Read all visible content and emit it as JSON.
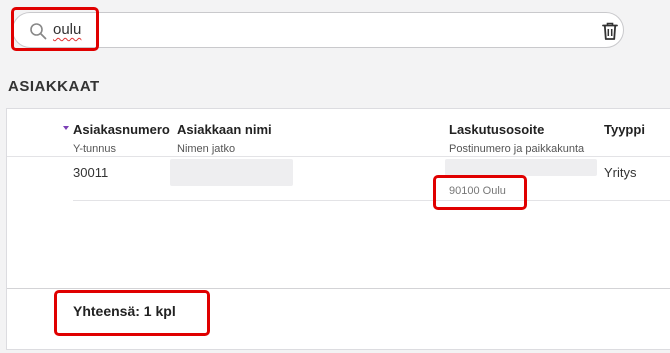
{
  "search": {
    "value": "oulu"
  },
  "section_title": "ASIAKKAAT",
  "table": {
    "columns": [
      {
        "title": "Asiakasnumero",
        "subtitle": "Y-tunnus"
      },
      {
        "title": "Asiakkaan nimi",
        "subtitle": "Nimen jatko"
      },
      {
        "title": "Laskutusosoite",
        "subtitle": "Postinumero ja paikkakunta"
      },
      {
        "title": "Tyyppi",
        "subtitle": ""
      }
    ],
    "rows": [
      {
        "number": "30011",
        "postal_city": "90100 Oulu",
        "type": "Yritys"
      }
    ]
  },
  "footer": {
    "total": "Yhteensä: 1 kpl"
  },
  "colors": {
    "highlight": "#e00000",
    "sort_accent": "#7b3fb5"
  }
}
